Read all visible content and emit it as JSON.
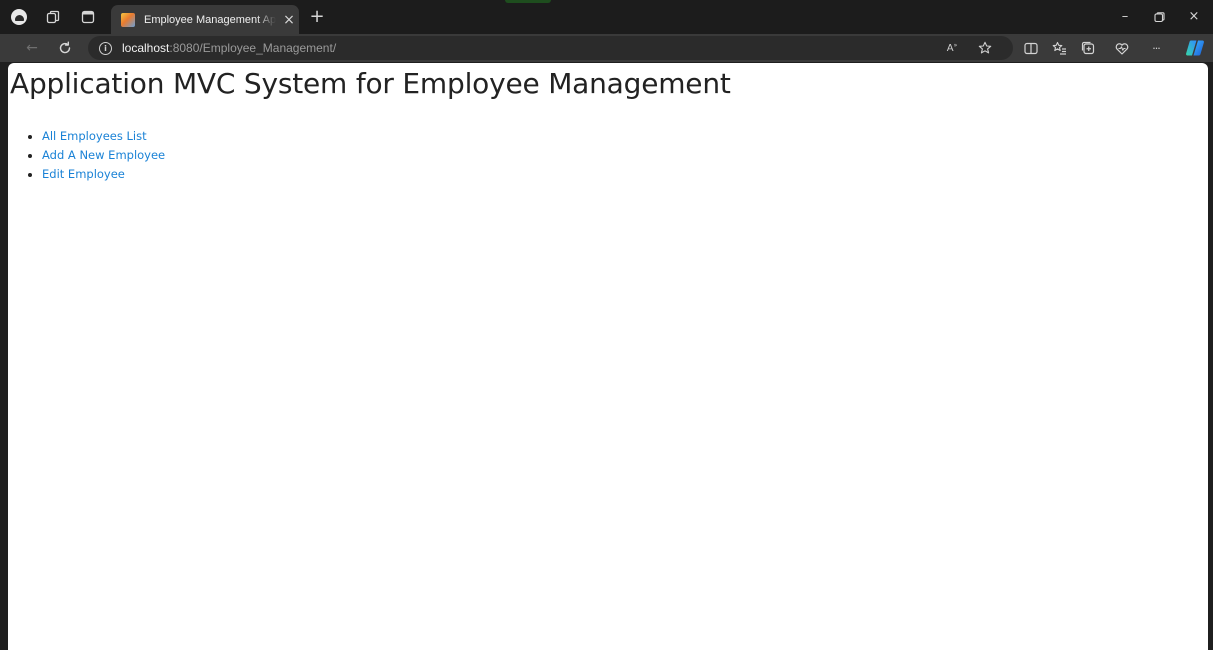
{
  "browser": {
    "tab": {
      "title": "Employee Management Application",
      "close_glyph": "×",
      "favicon": "app-favicon"
    },
    "new_tab_glyph": "+",
    "window_controls": {
      "minimize": "–",
      "restore": "▢",
      "close": "×"
    },
    "address_bar": {
      "host": "localhost",
      "rest": ":8080/Employee_Management/"
    },
    "nav": {
      "back_glyph": "←",
      "refresh_glyph": "↻"
    },
    "toolbar_icons": [
      "read-aloud-icon",
      "favorite-star-icon",
      "split-screen-icon",
      "favorites-icon",
      "collections-icon",
      "browser-essentials-icon",
      "more-icon",
      "copilot-icon"
    ],
    "read_aloud_label": "A",
    "more_glyph": "···"
  },
  "page": {
    "title": "Application MVC System for Employee Management",
    "links": [
      {
        "label": "All Employees List"
      },
      {
        "label": "Add A New Employee"
      },
      {
        "label": "Edit Employee"
      }
    ],
    "link_color": "#1a82d6"
  },
  "colors": {
    "frame": "#1c1c1c",
    "toolbar": "#3a3a3a",
    "omnibox": "#2b2b2b",
    "page_bg": "#ffffff",
    "title_text": "#222222"
  }
}
